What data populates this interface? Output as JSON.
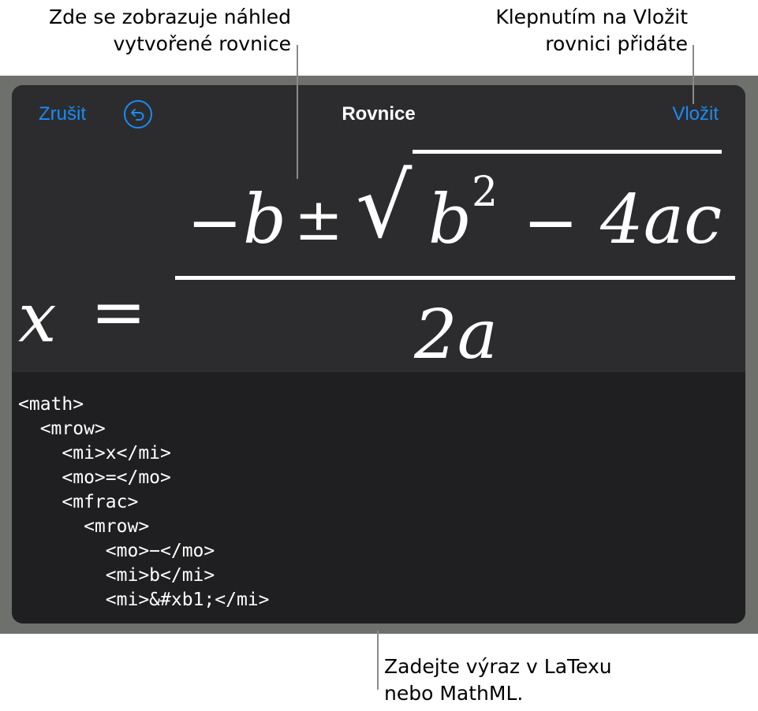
{
  "callouts": {
    "preview": [
      "Zde se zobrazuje náhled",
      "vytvořené rovnice"
    ],
    "insert": [
      "Klepnutím na Vložit",
      "rovnici přidáte"
    ],
    "input": [
      "Zadejte výraz v LaTexu",
      "nebo MathML."
    ]
  },
  "dialog": {
    "title": "Rovnice",
    "cancel_label": "Zrušit",
    "insert_label": "Vložit",
    "undo_icon": "undo-arrow-icon"
  },
  "formula": {
    "lhs": "x",
    "equals": "=",
    "minus": "−",
    "b": "b",
    "plus_minus": "±",
    "radical": "√",
    "radicand_base": "b",
    "exponent": "2",
    "radicand_minus": "−",
    "radicand_rest": "4ac",
    "denominator": "2a"
  },
  "code_lines": [
    "<math>",
    "  <mrow>",
    "    <mi>x</mi>",
    "    <mo>=</mo>",
    "    <mfrac>",
    "      <mrow>",
    "        <mo>−</mo>",
    "        <mi>b</mi>",
    "        <mi>&#xb1;</mi>"
  ],
  "colors": {
    "accent": "#1b8bf5",
    "frame": "#6e706c",
    "preview_bg": "#2c2c2e",
    "input_bg": "#1f1f21"
  }
}
